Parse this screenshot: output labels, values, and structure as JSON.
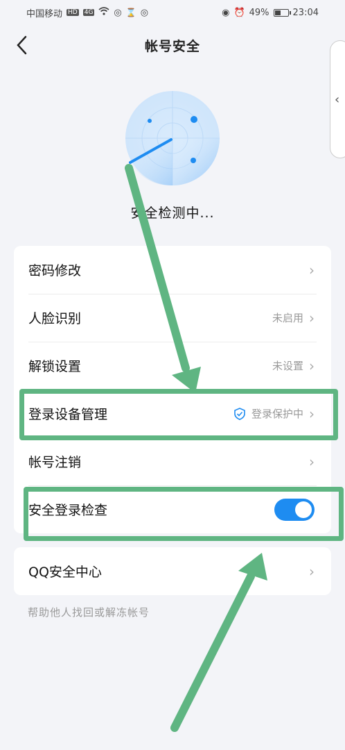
{
  "status_bar": {
    "carrier": "中国移动",
    "hd": "HD",
    "network": "4G",
    "battery": "49%",
    "battery_level": 0.49,
    "time": "23:04"
  },
  "header": {
    "title": "帐号安全"
  },
  "scan": {
    "text": "安全检测中..."
  },
  "menu": [
    {
      "label": "密码修改",
      "status": ""
    },
    {
      "label": "人脸识别",
      "status": "未启用"
    },
    {
      "label": "解锁设置",
      "status": "未设置"
    },
    {
      "label": "登录设备管理",
      "status": "登录保护中"
    },
    {
      "label": "帐号注销",
      "status": ""
    },
    {
      "label": "安全登录检查",
      "status": "",
      "toggle": true
    }
  ],
  "menu2": [
    {
      "label": "QQ安全中心",
      "status": ""
    }
  ],
  "hint": "帮助他人找回或解冻帐号",
  "colors": {
    "accent": "#1e8cf1",
    "highlight": "#5fb582",
    "background": "#f3f4f8"
  }
}
